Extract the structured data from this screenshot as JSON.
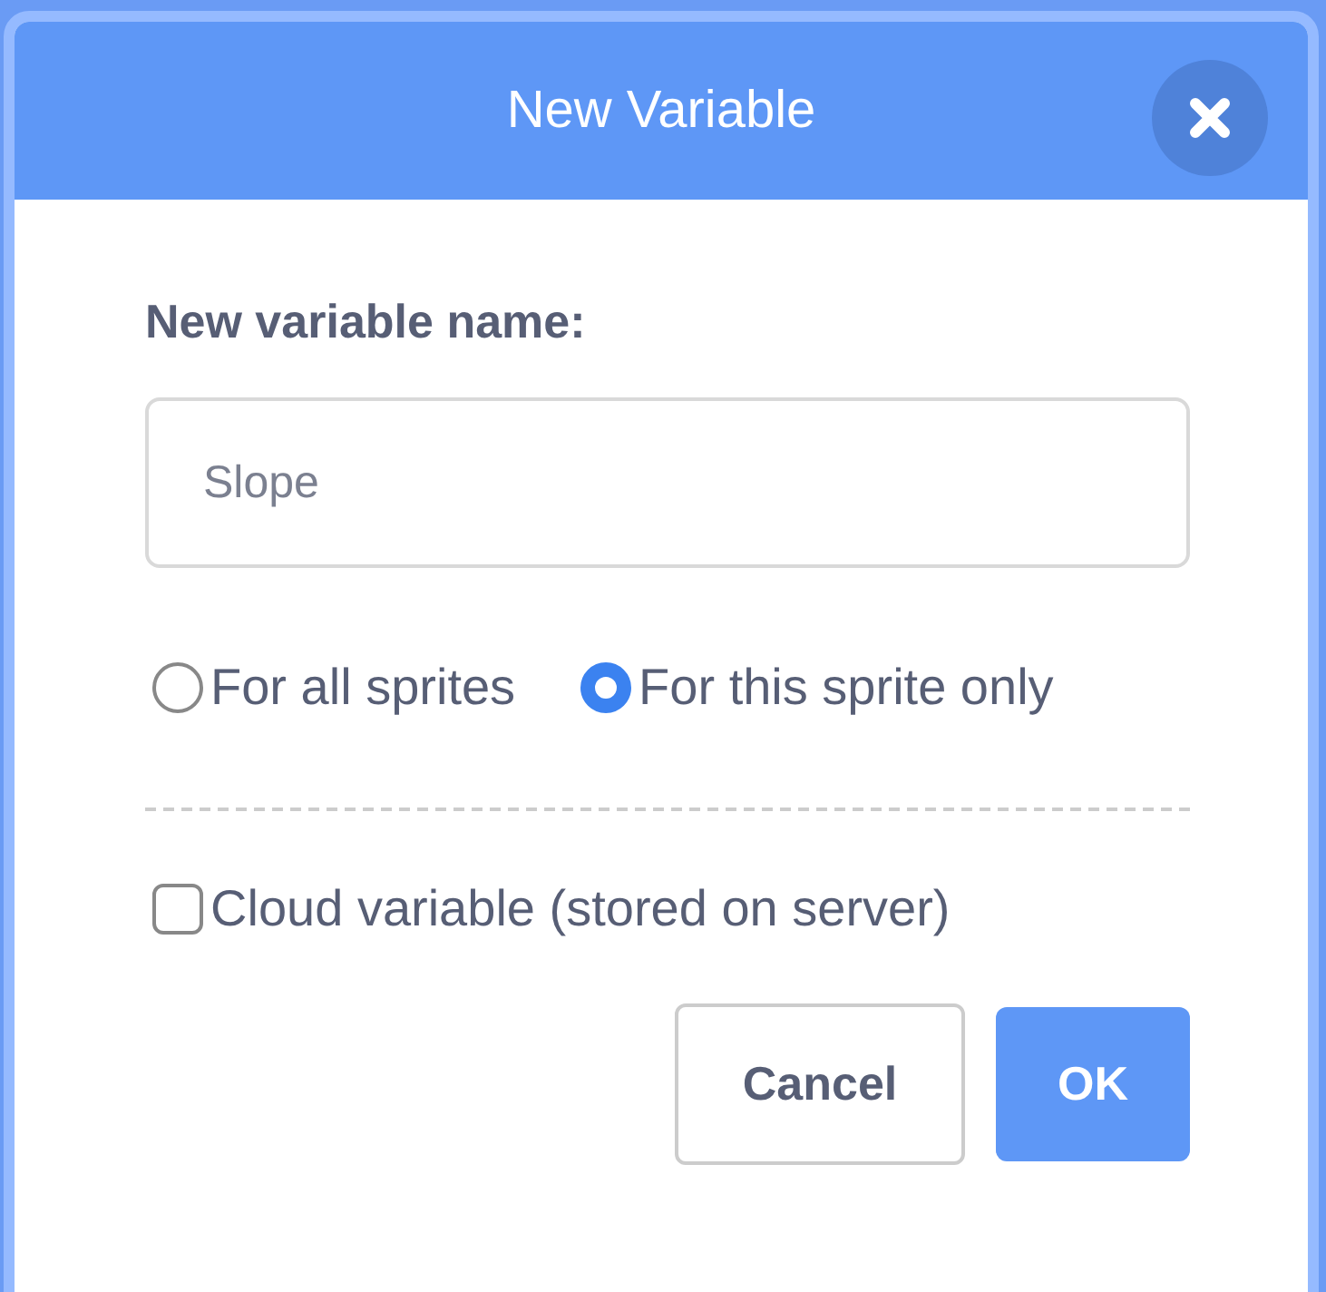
{
  "window": {
    "title": "New Variable"
  },
  "name_field": {
    "label": "New variable name:",
    "value": "Slope"
  },
  "scope": [
    {
      "label": "For all sprites",
      "selected": false
    },
    {
      "label": "For this sprite only",
      "selected": true
    }
  ],
  "cloud": {
    "label": "Cloud variable (stored on server)",
    "checked": false
  },
  "buttons": [
    {
      "label": "Cancel",
      "kind": "secondary"
    },
    {
      "label": "OK",
      "kind": "primary"
    }
  ]
}
